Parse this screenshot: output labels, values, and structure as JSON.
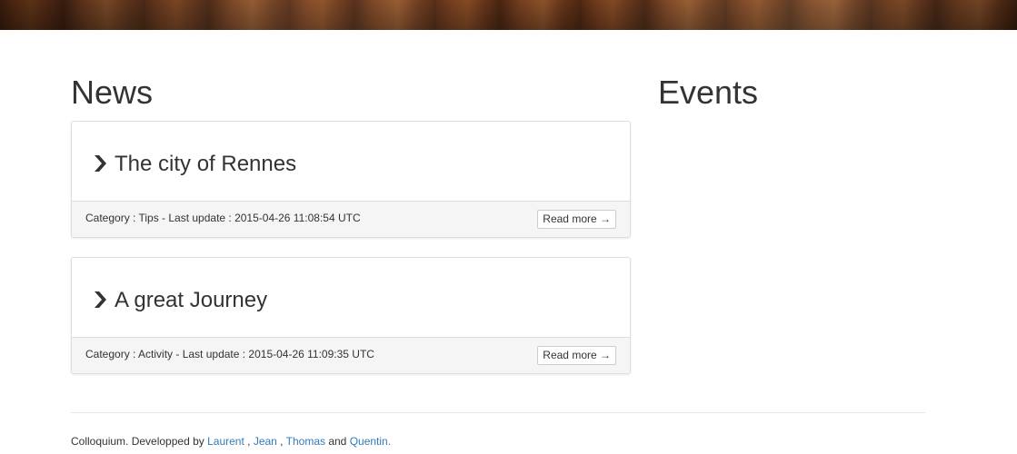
{
  "news": {
    "heading": "News",
    "items": [
      {
        "title": "The city of Rennes",
        "meta": "Category : Tips - Last update : 2015-04-26 11:08:54 UTC",
        "read_more": "Read more →"
      },
      {
        "title": "A great Journey",
        "meta": "Category : Activity - Last update : 2015-04-26 11:09:35 UTC",
        "read_more": "Read more →"
      }
    ]
  },
  "events": {
    "heading": "Events"
  },
  "footer": {
    "prefix": "Colloquium. Developped by ",
    "authors": [
      "Laurent",
      "Jean",
      "Thomas",
      "Quentin."
    ],
    "sep1": " , ",
    "sep2": " , ",
    "sep3": " and "
  },
  "colors": {
    "link": "#337ab7",
    "text": "#333333",
    "panel_footer_bg": "#f5f5f5"
  },
  "icons": {
    "panel_title_icon": "chevron-right-icon"
  }
}
